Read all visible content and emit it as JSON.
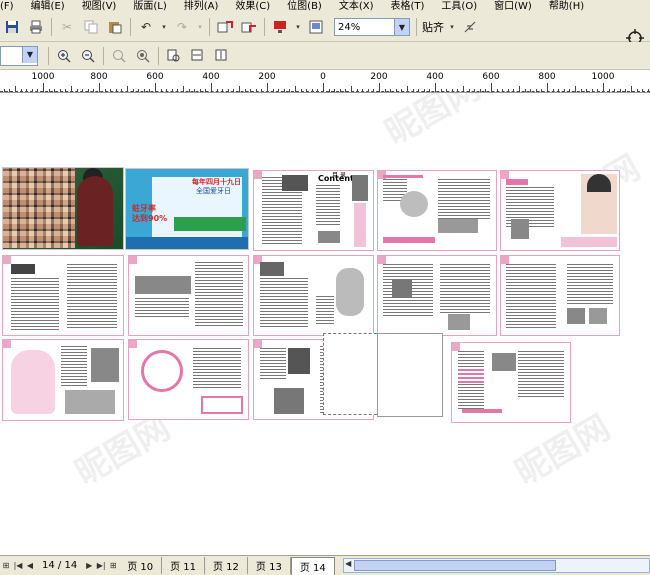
{
  "menubar": {
    "items": [
      "(F)",
      "编辑(E)",
      "视图(V)",
      "版面(L)",
      "排列(A)",
      "效果(C)",
      "位图(B)",
      "文本(X)",
      "表格(T)",
      "工具(O)",
      "窗口(W)",
      "帮助(H)"
    ]
  },
  "toolbar": {
    "zoom_value": "24%",
    "snap_label": "贴齐",
    "icons": [
      "save-icon",
      "print-icon",
      "cut-icon",
      "copy-icon",
      "paste-icon",
      "undo-icon",
      "redo-icon",
      "import-icon",
      "export-icon",
      "application-launcher-icon",
      "welcome-screen-icon",
      "snap-icon",
      "crosshair-icon"
    ]
  },
  "toolbar2": {
    "icons": [
      "zoom-in-icon",
      "zoom-out-icon",
      "zoom-selected-icon",
      "zoom-all-icon",
      "zoom-page-icon",
      "zoom-width-icon",
      "zoom-height-icon"
    ]
  },
  "ruler": {
    "labels": [
      "1000",
      "800",
      "600",
      "400",
      "200",
      "0",
      "200",
      "400",
      "600",
      "800",
      "1000"
    ]
  },
  "statusbar": {
    "page_count": "14 / 14",
    "tabs": [
      "页 10",
      "页 11",
      "页 12",
      "页 13",
      "页 14"
    ],
    "active_tab": "页 14"
  },
  "pages": {
    "cover2_text_1": "每年四月十九日",
    "cover2_text_2": "全国爱牙日",
    "cover2_text_3": "蛀牙率",
    "cover2_text_4": "达到90%",
    "page_title_contents": "Contents",
    "page_title_mulu": "目 录"
  },
  "colors": {
    "ui_gray": "#ece9d8",
    "accent_pink": "#e377a7",
    "cover_green": "#2e6a3e",
    "cover_blue": "#3aa7d4"
  }
}
